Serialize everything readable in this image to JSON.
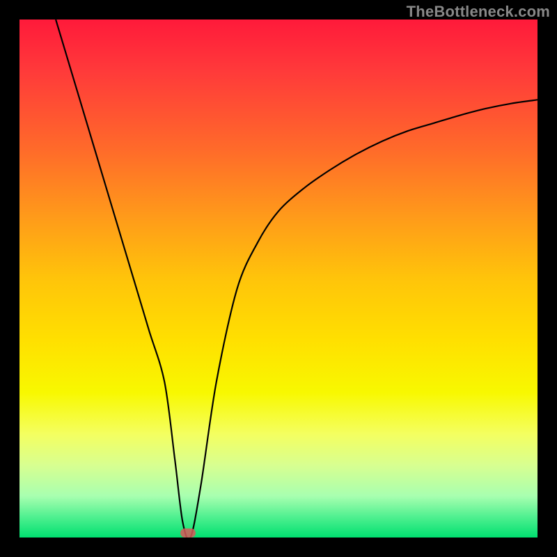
{
  "watermark": "TheBottleneck.com",
  "chart_data": {
    "type": "line",
    "title": "",
    "xlabel": "",
    "ylabel": "",
    "xlim": [
      0,
      100
    ],
    "ylim": [
      0,
      100
    ],
    "grid": false,
    "series": [
      {
        "name": "bottleneck-curve",
        "x": [
          7,
          10,
          13,
          16,
          19,
          22,
          25,
          28,
          30,
          31.5,
          33,
          35,
          38,
          42,
          46,
          50,
          55,
          60,
          65,
          70,
          75,
          80,
          85,
          90,
          95,
          100
        ],
        "y": [
          100,
          90,
          80,
          70,
          60,
          50,
          40,
          30,
          15,
          3,
          0,
          10,
          30,
          48,
          57,
          63,
          67.5,
          71,
          74,
          76.5,
          78.5,
          80,
          81.5,
          82.8,
          83.8,
          84.5
        ],
        "color": "#000000"
      }
    ],
    "marker": {
      "x": 32.5,
      "y": 1
    },
    "background": {
      "type": "vertical-gradient",
      "stops": [
        {
          "pos": 0,
          "color": "#ff1a3a"
        },
        {
          "pos": 50,
          "color": "#ffc40a"
        },
        {
          "pos": 75,
          "color": "#f8f800"
        },
        {
          "pos": 100,
          "color": "#00e070"
        }
      ]
    }
  }
}
